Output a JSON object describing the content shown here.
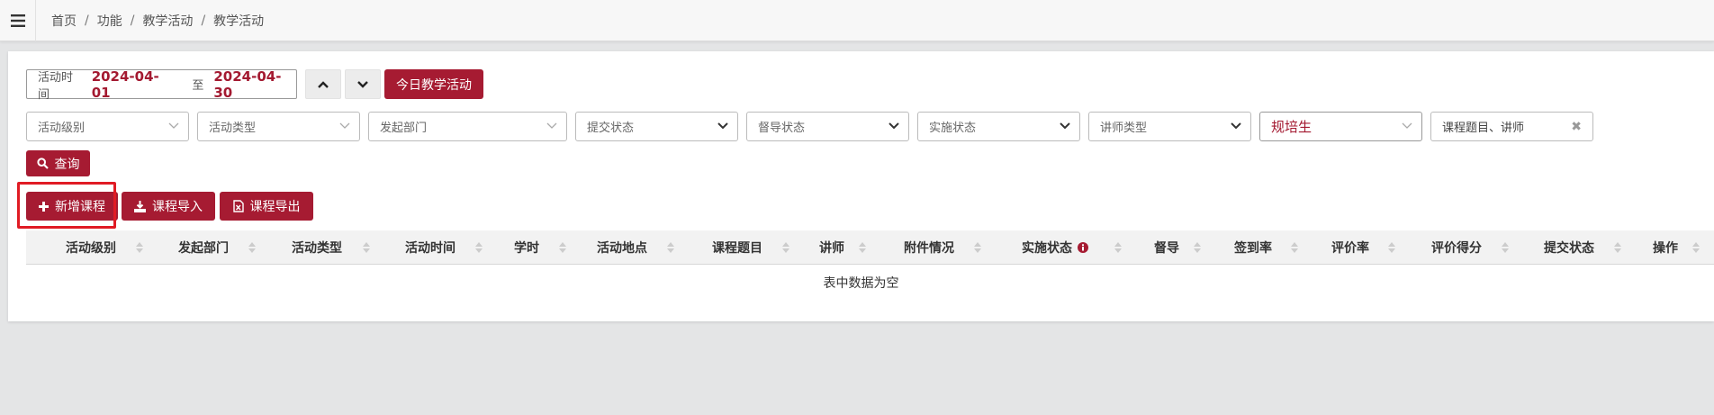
{
  "breadcrumb": [
    "首页",
    "功能",
    "教学活动",
    "教学活动"
  ],
  "breadcrumb_separator": "/",
  "date_filter": {
    "label": "活动时间",
    "start": "2024-04-01",
    "to": "至",
    "end": "2024-04-30"
  },
  "today_button": "今日教学活动",
  "filters": {
    "activity_level": "活动级别",
    "activity_type": "活动类型",
    "department": "发起部门",
    "submit_status": "提交状态",
    "supervision_status": "督导状态",
    "implementation_status": "实施状态",
    "lecturer_type": "讲师类型",
    "trainee_type": "规培生",
    "keyword": "课程题目、讲师",
    "clear_symbol": "✖"
  },
  "search_button": "查询",
  "actions": {
    "add": "新增课程",
    "import": "课程导入",
    "export": "课程导出"
  },
  "table": {
    "columns": [
      "活动级别",
      "发起部门",
      "活动类型",
      "活动时间",
      "学时",
      "活动地点",
      "课程题目",
      "讲师",
      "附件情况",
      "实施状态",
      "督导",
      "签到率",
      "评价率",
      "评价得分",
      "提交状态",
      "操作"
    ],
    "empty_text": "表中数据为空"
  },
  "colors": {
    "accent": "#a61b32",
    "highlight": "#e01b24"
  }
}
